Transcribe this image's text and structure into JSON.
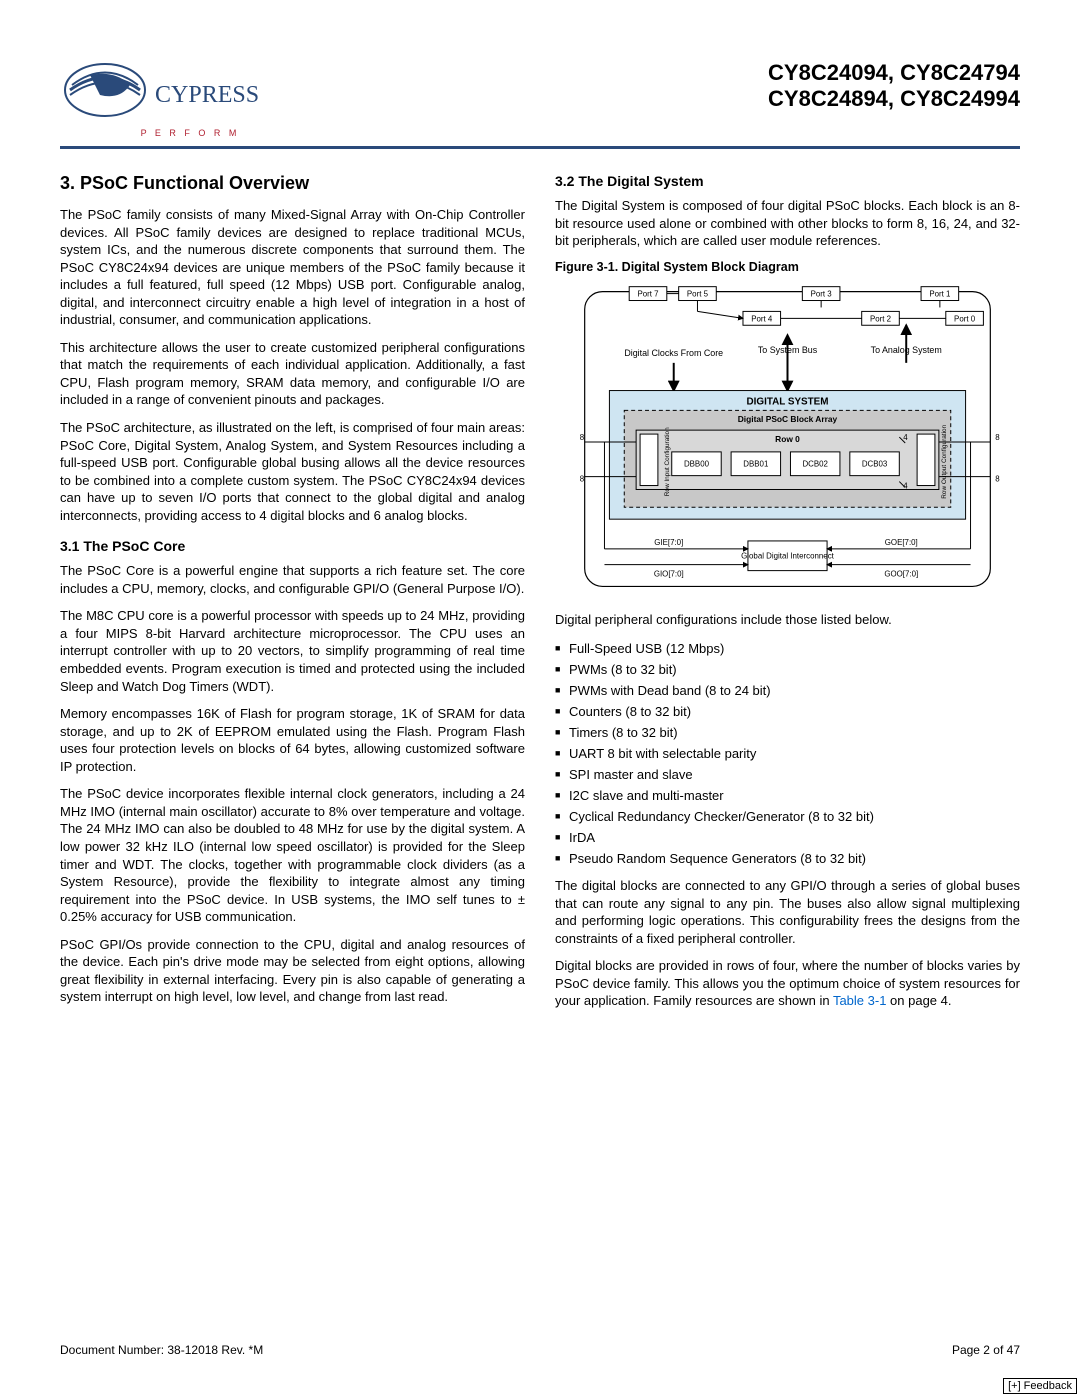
{
  "header": {
    "logo_text": "CYPRESS",
    "logo_tagline": "P E R F O R M",
    "title_line1": "CY8C24094, CY8C24794",
    "title_line2": "CY8C24894, CY8C24994"
  },
  "section3": {
    "heading": "3.  PSoC Functional Overview",
    "p1": "The PSoC family consists of many Mixed-Signal Array with On-Chip Controller devices. All PSoC family devices are designed to replace traditional MCUs, system ICs, and the numerous discrete components that surround them. The PSoC CY8C24x94 devices are unique members of the PSoC family because it includes a full featured, full speed (12 Mbps) USB port. Configurable analog, digital, and interconnect circuitry enable a high level of integration in a host of industrial, consumer, and communication applications.",
    "p2": "This architecture allows the user to create customized peripheral configurations that match the requirements of each individual application. Additionally, a fast CPU, Flash program memory, SRAM data memory, and configurable I/O are included in a range of convenient pinouts and packages.",
    "p3": "The PSoC architecture, as illustrated on the left, is comprised of four main areas: PSoC Core, Digital System, Analog System, and System Resources including a full-speed USB port. Configurable global busing allows all the device resources to be combined into a complete custom system. The PSoC CY8C24x94 devices can have up to seven I/O ports that connect to the global digital and analog interconnects, providing access to 4 digital blocks and 6 analog blocks."
  },
  "section31": {
    "heading": "3.1  The PSoC Core",
    "p1": "The PSoC Core is a powerful engine that supports a rich feature set. The core includes a CPU, memory, clocks, and configurable GPI/O (General Purpose I/O).",
    "p2": "The M8C CPU core is a powerful processor with speeds up to 24 MHz, providing a four MIPS 8-bit Harvard architecture microprocessor. The CPU uses an interrupt controller with up to 20 vectors, to simplify programming of real time embedded events. Program execution is timed and protected using the included Sleep and Watch Dog Timers (WDT).",
    "p3": "Memory encompasses 16K of Flash for program storage, 1K of SRAM for data storage, and up to 2K of EEPROM emulated using the Flash. Program Flash uses four protection levels on blocks of 64 bytes, allowing customized software IP protection.",
    "p4": "The PSoC device incorporates flexible internal clock generators, including a 24 MHz IMO (internal main oscillator) accurate to 8% over temperature and voltage. The 24 MHz IMO can also be doubled to 48 MHz for use by the digital system. A low power 32 kHz ILO (internal low speed oscillator) is provided for the Sleep timer and WDT. The clocks, together with programmable clock dividers (as a System Resource), provide the flexibility to integrate almost any timing requirement into the PSoC device. In USB systems, the IMO self tunes to ± 0.25% accuracy for USB communication.",
    "p5": "PSoC GPI/Os provide connection to the CPU, digital and analog resources of the device. Each pin's drive mode may be selected from eight options, allowing great flexibility in external interfacing. Every pin is also capable of generating a system interrupt on high level, low level, and change from last read."
  },
  "section32": {
    "heading": "3.2  The Digital System",
    "p1": "The Digital System is composed of four digital PSoC blocks. Each block is an 8-bit resource used alone or combined with other blocks to form 8, 16, 24, and 32-bit peripherals, which are called user module references.",
    "fig_caption": "Figure 3-1.  Digital System Block Diagram",
    "p2": "Digital peripheral configurations include those listed below.",
    "bullets": [
      "Full-Speed USB (12 Mbps)",
      "PWMs (8 to 32 bit)",
      "PWMs with Dead band (8 to 24 bit)",
      "Counters (8 to 32 bit)",
      "Timers (8 to 32 bit)",
      "UART 8 bit with selectable parity",
      "SPI master and slave",
      "I2C slave and multi-master",
      "Cyclical Redundancy Checker/Generator (8 to 32 bit)",
      "IrDA",
      "Pseudo Random Sequence Generators (8 to 32 bit)"
    ],
    "p3": "The digital blocks are connected to any GPI/O through a series of global buses that can route any signal to any pin. The buses also allow signal multiplexing and performing logic operations. This configurability frees the designs from the constraints of a fixed peripheral controller.",
    "p4_before": "Digital blocks are provided in rows of four, where the number of blocks varies by PSoC device family. This allows you the optimum choice of system resources for your application. Family resources are shown in ",
    "p4_link": "Table 3-1",
    "p4_after": " on page 4."
  },
  "diagram": {
    "ports": [
      "Port 7",
      "Port 5",
      "Port 3",
      "Port 1",
      "Port 4",
      "Port 2",
      "Port 0"
    ],
    "labels": {
      "clocks": "Digital Clocks From Core",
      "sysbus": "To System Bus",
      "analog": "To Analog System",
      "system": "DIGITAL  SYSTEM",
      "array": "Digital PSoC Block Array",
      "row": "Row 0",
      "rowin": "Row Input Configuration",
      "rowout": "Row Output Configuration",
      "gdi": "Global Digital Interconnect",
      "gie": "GIE[7:0]",
      "gio": "GIO[7:0]",
      "goe": "GOE[7:0]",
      "goo": "GOO[7:0]",
      "bus8l": "8",
      "bus8r": "8",
      "bus4": "4"
    },
    "blocks": [
      "DBB00",
      "DBB01",
      "DCB02",
      "DCB03"
    ]
  },
  "footer": {
    "docnum": "Document Number: 38-12018 Rev. *M",
    "page": "Page 2 of 47"
  },
  "feedback_button": "[+] Feedback"
}
